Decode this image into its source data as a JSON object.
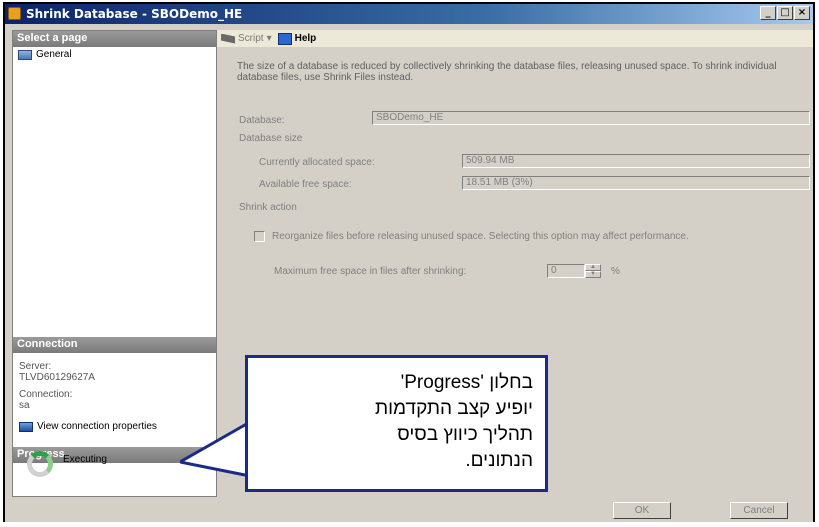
{
  "window": {
    "title": "Shrink Database - SBODemo_HE",
    "controls": [
      "_",
      "□",
      "×"
    ]
  },
  "left_pane": {
    "select_page_header": "Select a page",
    "pages": [
      {
        "label": "General",
        "icon": "general-page-icon"
      }
    ],
    "connection_header": "Connection",
    "server_label": "Server:",
    "server_value": "TLVD60129627A",
    "connection_label": "Connection:",
    "connection_value": "sa",
    "view_connection_label": "View connection properties",
    "progress_header": "Progress",
    "progress_status": "Executing"
  },
  "toolbar": {
    "script_label": "Script",
    "script_dropdown": "▾",
    "help_label": "Help"
  },
  "main": {
    "description": "The size of a database is reduced by collectively shrinking the database files, releasing unused space. To shrink individual database files, use Shrink Files instead.",
    "database_label": "Database:",
    "database_value": "SBODemo_HE",
    "database_size_label": "Database size",
    "allocated_label": "Currently allocated space:",
    "allocated_value": "509.94 MB",
    "free_label": "Available free space:",
    "free_value": "18.51 MB (3%)",
    "shrink_action_label": "Shrink action",
    "reorganize_label": "Reorganize files before releasing unused space.  Selecting this option may affect performance.",
    "max_free_label": "Maximum free space in files after shrinking:",
    "max_free_value": "0",
    "percent_sign": "%"
  },
  "buttons": {
    "ok": "OK",
    "cancel": "Cancel"
  },
  "callout": {
    "text": "בחלון  'Progress'\nיופיע קצב התקדמות\nתהליך כיווץ בסיס\nהנתונים."
  }
}
